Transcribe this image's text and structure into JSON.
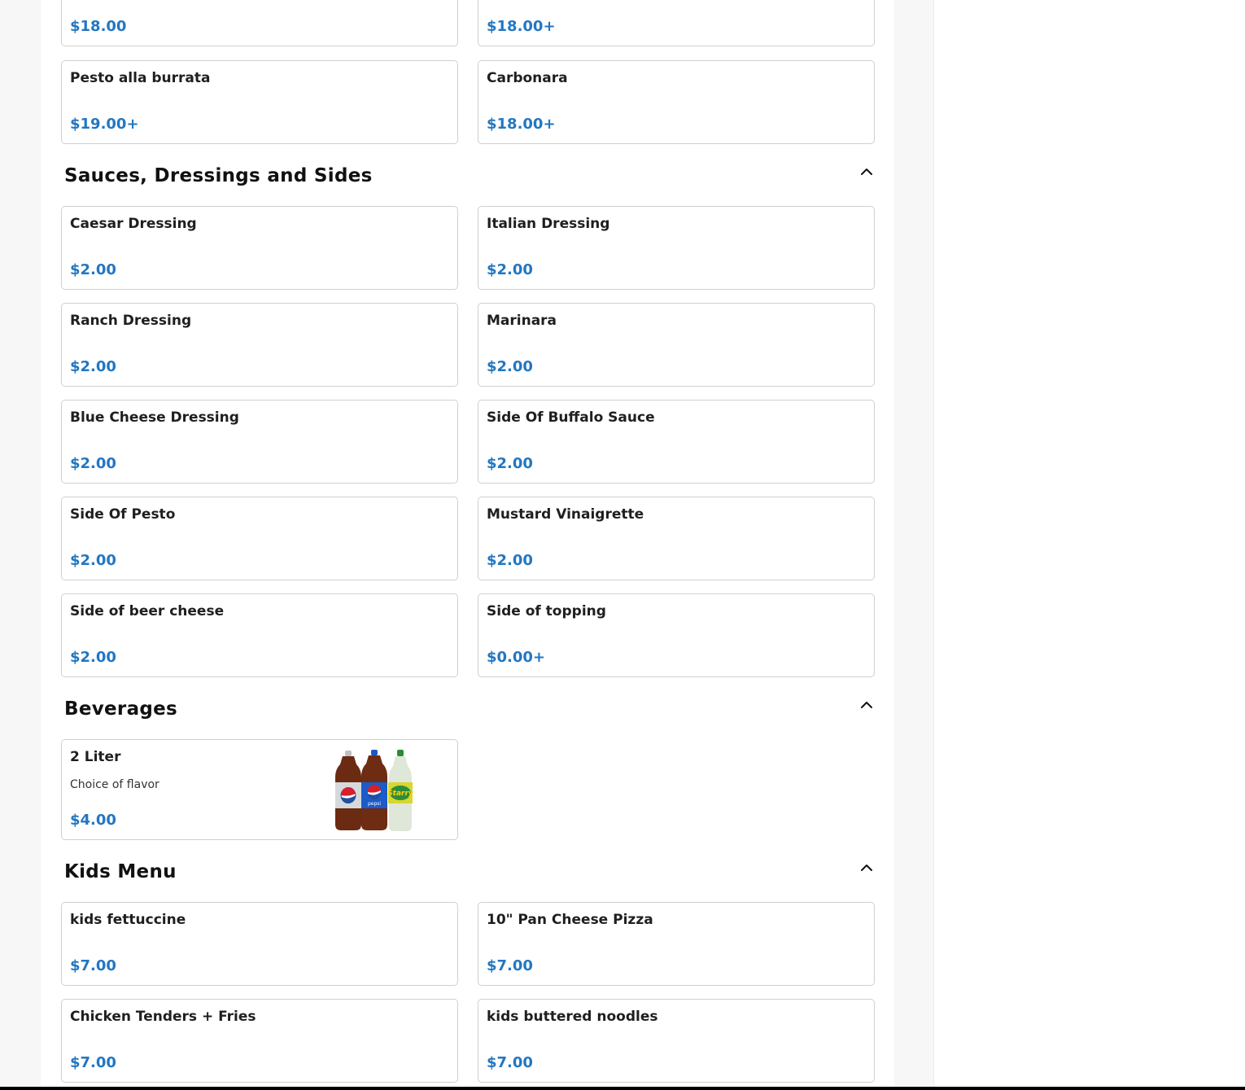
{
  "colors": {
    "price": "#2277c2",
    "border": "#d0d0d0"
  },
  "top_cards": [
    {
      "price": "$18.00"
    },
    {
      "price": "$18.00+"
    },
    {
      "name": "Pesto alla burrata",
      "price": "$19.00+"
    },
    {
      "name": "Carbonara",
      "price": "$18.00+"
    }
  ],
  "sections": [
    {
      "title": "Sauces, Dressings and Sides",
      "collapse_icon": "chevron-up-icon",
      "items": [
        {
          "name": "Caesar Dressing",
          "price": "$2.00"
        },
        {
          "name": "Italian Dressing",
          "price": "$2.00"
        },
        {
          "name": "Ranch Dressing",
          "price": "$2.00"
        },
        {
          "name": "Marinara",
          "price": "$2.00"
        },
        {
          "name": "Blue Cheese Dressing",
          "price": "$2.00"
        },
        {
          "name": "Side Of Buffalo Sauce",
          "price": "$2.00"
        },
        {
          "name": "Side Of Pesto",
          "price": "$2.00"
        },
        {
          "name": "Mustard Vinaigrette",
          "price": "$2.00"
        },
        {
          "name": "Side of beer cheese",
          "price": "$2.00"
        },
        {
          "name": "Side of topping",
          "price": "$0.00+"
        }
      ]
    },
    {
      "title": "Beverages",
      "collapse_icon": "chevron-up-icon",
      "items": [
        {
          "name": "2 Liter",
          "description": "Choice of flavor",
          "price": "$4.00",
          "image": "soda-bottles-image"
        }
      ]
    },
    {
      "title": "Kids Menu",
      "collapse_icon": "chevron-up-icon",
      "items": [
        {
          "name": "kids fettuccine",
          "price": "$7.00"
        },
        {
          "name": "10\" Pan Cheese Pizza",
          "price": "$7.00"
        },
        {
          "name": "Chicken Tenders + Fries",
          "price": "$7.00"
        },
        {
          "name": "kids buttered noodles",
          "price": "$7.00"
        }
      ]
    }
  ]
}
